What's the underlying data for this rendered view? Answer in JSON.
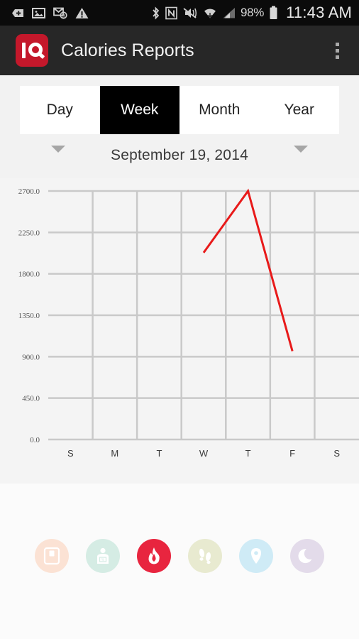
{
  "status_bar": {
    "icons_left": [
      "tag-plus-icon",
      "image-icon",
      "email-sync-icon",
      "warning-icon"
    ],
    "icons_right": [
      "bluetooth-icon",
      "nfc-icon",
      "mute-vibrate-icon",
      "wifi-icon",
      "cellular-signal-icon"
    ],
    "battery_percent": "98%",
    "time": "11:43 AM",
    "background_color": "#0b0b0b"
  },
  "action_bar": {
    "logo_name": "iq-app-logo",
    "logo_color": "#c4182b",
    "title": "Calories Reports",
    "overflow_icon": "overflow-menu-icon",
    "background_color": "#272727"
  },
  "tabs": {
    "items": [
      {
        "label": "Day",
        "active": false
      },
      {
        "label": "Week",
        "active": true
      },
      {
        "label": "Month",
        "active": false
      },
      {
        "label": "Year",
        "active": false
      }
    ],
    "active_background": "#000000",
    "inactive_background": "#ffffff"
  },
  "date_nav": {
    "prev_icon": "chevron-down-icon",
    "next_icon": "chevron-down-icon",
    "date": "September 19, 2014"
  },
  "chart_data": {
    "type": "line",
    "title": "",
    "xlabel": "",
    "ylabel": "",
    "categories": [
      "S",
      "M",
      "T",
      "W",
      "T",
      "F",
      "S"
    ],
    "series": [
      {
        "name": "Calories",
        "color": "#e81a1a",
        "values": [
          null,
          null,
          null,
          2030,
          2700,
          960,
          null
        ]
      }
    ],
    "ytick_labels": [
      "2700.0",
      "2250.0",
      "1800.0",
      "1350.0",
      "900.0",
      "450.0",
      "0.0"
    ],
    "yticks": [
      2700,
      2250,
      1800,
      1350,
      900,
      450,
      0
    ],
    "ylim": [
      0,
      2700
    ],
    "grid": true,
    "legend": false,
    "grid_color": "#c9c9c9",
    "plot_background": "#f4f4f4"
  },
  "icon_bar": {
    "items": [
      {
        "name": "scale-icon",
        "bg": "#fbe2d4",
        "fg": "#ffffff",
        "active": false
      },
      {
        "name": "body-fat-icon",
        "bg": "#d5ece4",
        "fg": "#ffffff",
        "active": false
      },
      {
        "name": "flame-icon",
        "bg": "#e8253f",
        "fg": "#ffffff",
        "active": true
      },
      {
        "name": "footsteps-icon",
        "bg": "#e8ead0",
        "fg": "#ffffff",
        "active": false
      },
      {
        "name": "location-pin-icon",
        "bg": "#cfebf6",
        "fg": "#ffffff",
        "active": false
      },
      {
        "name": "moon-icon",
        "bg": "#e3dbea",
        "fg": "#ffffff",
        "active": false
      }
    ]
  }
}
